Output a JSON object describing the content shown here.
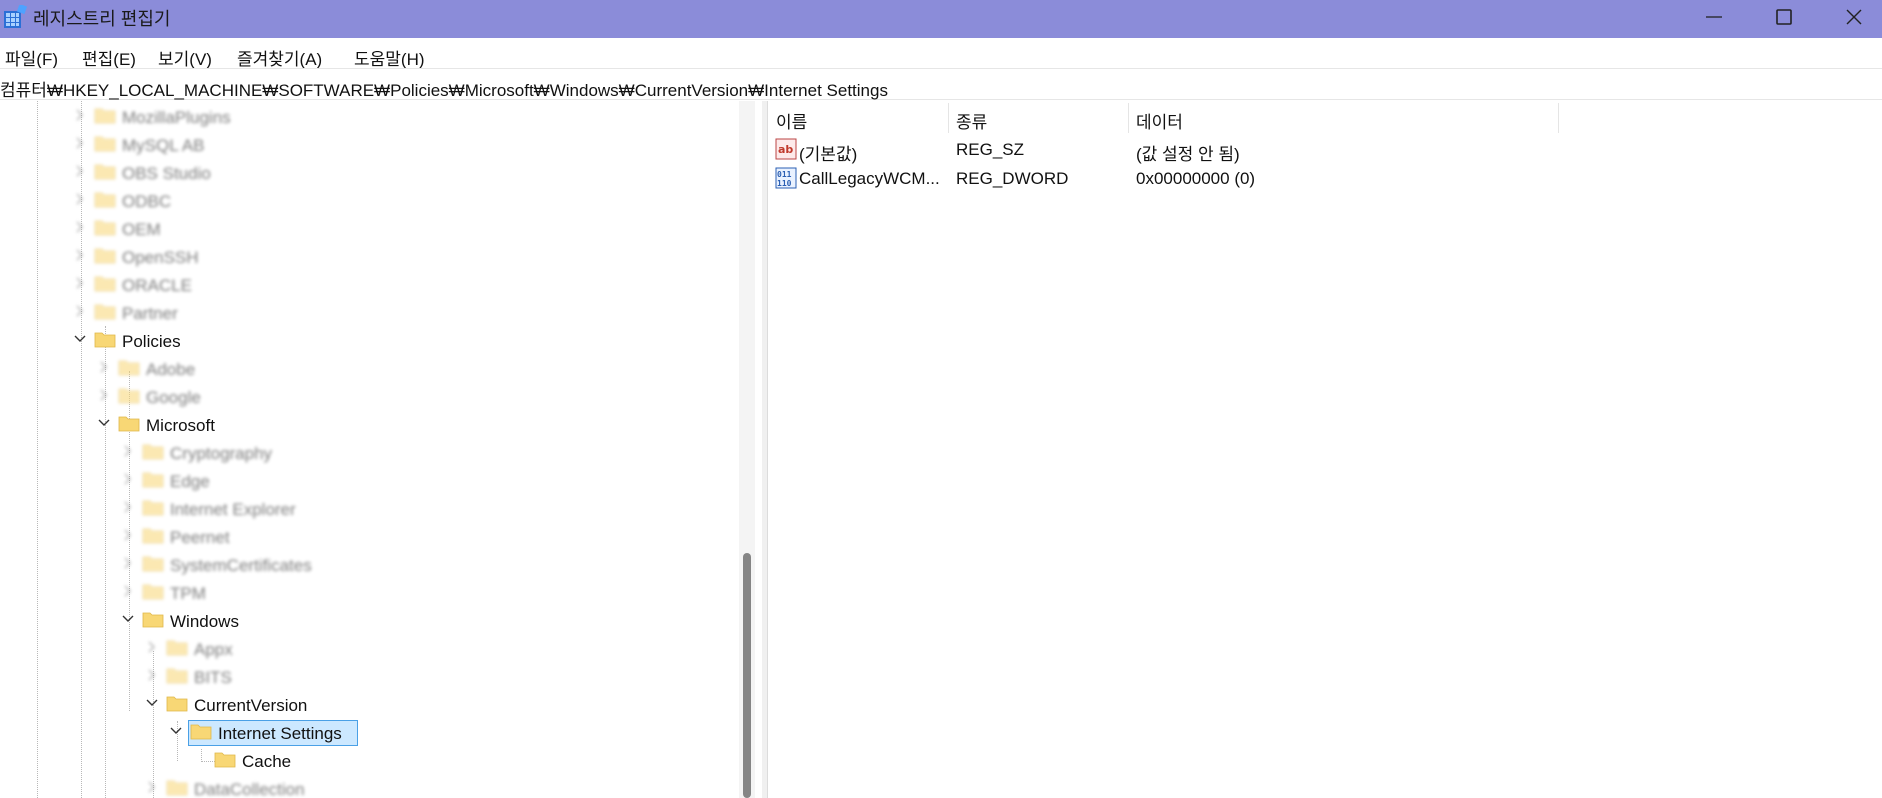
{
  "window": {
    "title": "레지스트리 편집기",
    "icon": "registry-editor-icon",
    "controls": [
      "minimize-icon",
      "maximize-icon",
      "close-icon"
    ]
  },
  "menu": [
    "파일(F)",
    "편집(E)",
    "보기(V)",
    "즐겨찾기(A)",
    "도움말(H)"
  ],
  "address": "컴퓨터₩HKEY_LOCAL_MACHINE₩SOFTWARE₩Policies₩Microsoft₩Windows₩CurrentVersion₩Internet Settings",
  "tree": {
    "blurred_top": [
      "MozillaPlugins",
      "MySQL AB",
      "OBS Studio",
      "ODBC",
      "OEM",
      "OpenSSH",
      "ORACLE",
      "Partner"
    ],
    "policies": "Policies",
    "policies_children_blurred": [
      "Adobe",
      "Google"
    ],
    "microsoft": "Microsoft",
    "microsoft_children_blurred": [
      "Cryptography",
      "Edge",
      "Internet Explorer",
      "Peernet",
      "SystemCertificates",
      "TPM"
    ],
    "windows": "Windows",
    "windows_children_blurred": [
      "Appx",
      "BITS"
    ],
    "current_version": "CurrentVersion",
    "internet_settings": "Internet Settings",
    "cache": "Cache",
    "data_collection": "DataCollection"
  },
  "values": {
    "columns": [
      "이름",
      "종류",
      "데이터"
    ],
    "rows": [
      {
        "icon": "string-value-icon",
        "name": "(기본값)",
        "type": "REG_SZ",
        "data": "(값 설정 안 됨)"
      },
      {
        "icon": "binary-value-icon",
        "name": "CallLegacyWCM...",
        "type": "REG_DWORD",
        "data": "0x00000000 (0)"
      }
    ]
  },
  "colors": {
    "titlebar": "#8b8cd9",
    "selection": "#cce8ff",
    "selection_border": "#4aa0e6",
    "folder": "#f8d775"
  }
}
